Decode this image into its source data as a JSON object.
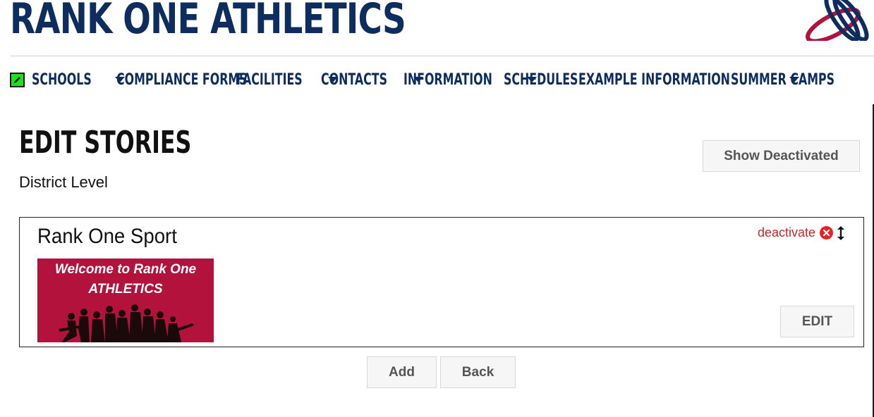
{
  "header": {
    "brand": "RANK ONE ATHLETICS"
  },
  "nav": {
    "items": [
      {
        "label": "SCHOOLS",
        "has_dropdown": true
      },
      {
        "label": "COMPLIANCE FORMS",
        "has_dropdown": false
      },
      {
        "label": "FACILITIES",
        "has_dropdown": true
      },
      {
        "label": "CONTACTS",
        "has_dropdown": true
      },
      {
        "label": "INFORMATION",
        "has_dropdown": true
      },
      {
        "label": "SCHEDULES",
        "has_dropdown": false
      },
      {
        "label": "EXAMPLE INFORMATION",
        "has_dropdown": true
      },
      {
        "label": "SUMMER CAMPS",
        "has_dropdown": false
      }
    ],
    "edit_toggle_icon": "pencil-icon"
  },
  "page": {
    "title": "EDIT STORIES",
    "subtitle": "District Level",
    "show_deactivated_label": "Show Deactivated"
  },
  "stories": [
    {
      "title": "Rank One Sport",
      "deactivate_label": "deactivate",
      "edit_label": "EDIT",
      "image": {
        "line1": "Welcome to Rank One",
        "line2": "ATHLETICS"
      }
    }
  ],
  "actions": {
    "add_label": "Add",
    "back_label": "Back"
  },
  "colors": {
    "brand_navy": "#0c2d5e",
    "brand_red": "#b3123c",
    "edit_toggle_green": "#19e619",
    "deactivate_red": "#c62828"
  }
}
